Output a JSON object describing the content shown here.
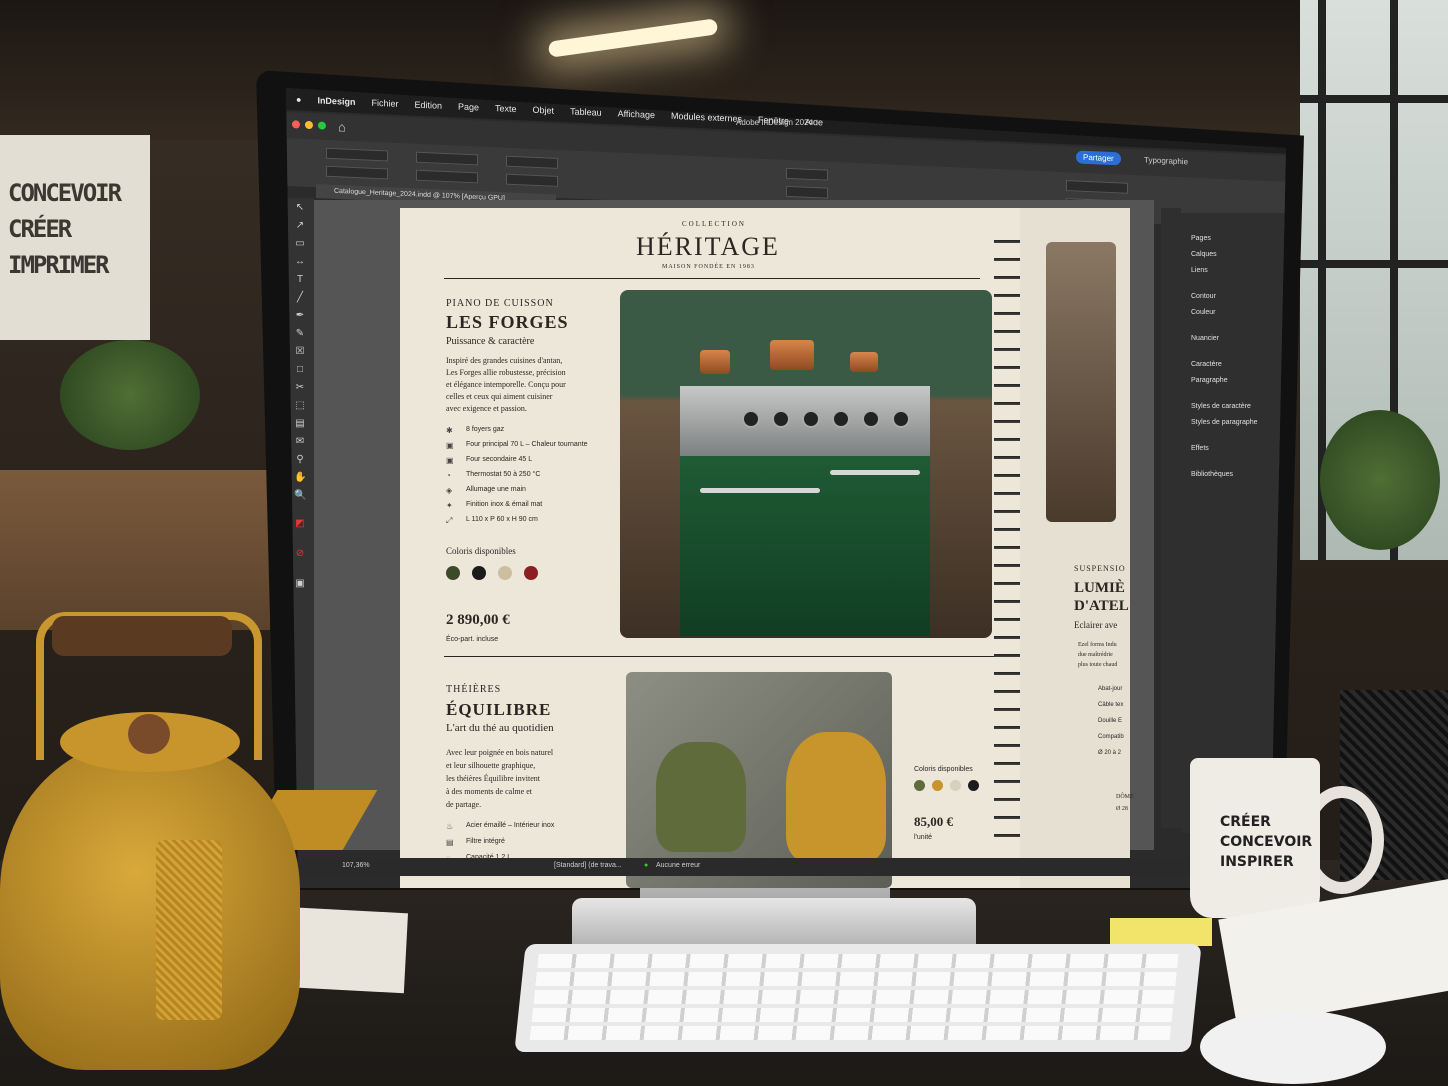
{
  "menubar": {
    "items": [
      "InDesign",
      "Fichier",
      "Edition",
      "Page",
      "Texte",
      "Objet",
      "Tableau",
      "Affichage",
      "Modules externes",
      "Fenêtre",
      "Aide"
    ]
  },
  "titlebar": {
    "title": "Adobe InDesign 2024",
    "share": "Partager",
    "workspace": "Typographie"
  },
  "document_tab": "Catalogue_Heritage_2024.indd @ 107% [Aperçu GPU]",
  "right_panel": {
    "items": [
      "Pages",
      "Calques",
      "Liens",
      "Contour",
      "Couleur",
      "Nuancier",
      "Caractère",
      "Paragraphe",
      "Styles de caractère",
      "Styles de paragraphe",
      "Effets",
      "Bibliothèques"
    ]
  },
  "statusbar": {
    "zoom": "107,36%",
    "profile": "[Standard] (de trava...",
    "errors": "Aucune erreur"
  },
  "page": {
    "collection": "COLLECTION",
    "brand": "HÉRITAGE",
    "tagline": "MAISON FONDÉE EN 1983",
    "product1": {
      "category": "PIANO DE CUISSON",
      "name": "LES FORGES",
      "subtitle": "Puissance & caractère",
      "description": [
        "Inspiré des grandes cuisines d'antan,",
        "Les Forges allie robustesse, précision",
        "et élégance intemporelle. Conçu pour",
        "celles et ceux qui aiment cuisiner",
        "avec exigence et passion."
      ],
      "features": [
        "8 foyers gaz",
        "Four principal 70 L – Chaleur tournante",
        "Four secondaire 45 L",
        "Thermostat 50 à 250 °C",
        "Allumage une main",
        "Finition inox & émail mat",
        "L 110 x P 60 x H 90 cm"
      ],
      "colors_label": "Coloris disponibles",
      "colors": [
        "#3d4a2a",
        "#1b1b1b",
        "#cbbf9f",
        "#8b1f22"
      ],
      "price": "2 890,00 €",
      "price_note": "Éco-part. incluse"
    },
    "product2": {
      "category": "THÉIÈRES",
      "name": "ÉQUILIBRE",
      "subtitle": "L'art du thé au quotidien",
      "description": [
        "Avec leur poignée en bois naturel",
        "et leur silhouette graphique,",
        "les théières Équilibre invitent",
        "à des moments de calme et",
        "de partage."
      ],
      "features": [
        "Acier émaillé – Intérieur inox",
        "Filtre intégré",
        "Capacité 1,2 L"
      ],
      "colors_label": "Coloris disponibles",
      "colors": [
        "#5f6b3a",
        "#c8952c",
        "#d8cfbd",
        "#1c1c1c"
      ],
      "price": "85,00 €",
      "price_note": "l'unité"
    },
    "facing": {
      "category": "SUSPENSIO",
      "name1": "LUMIÈ",
      "name2": "D'ATEL",
      "subtitle": "Eclairer ave",
      "description": [
        "Ezel forms Indu",
        "due maîtrédrie",
        "plus toute chaud"
      ],
      "features": [
        "Abat-jour",
        "Câble tex",
        "Douille E",
        "Compatib",
        "Ø 20 à 2"
      ],
      "footer": "DÔME",
      "footer2": "Ø 28"
    }
  },
  "wall_sign": [
    "CONCEVOIR",
    "CRÉER",
    "IMPRIMER"
  ],
  "mug_text": [
    "CRÉER",
    "CONCEVOIR",
    "INSPIRER"
  ]
}
